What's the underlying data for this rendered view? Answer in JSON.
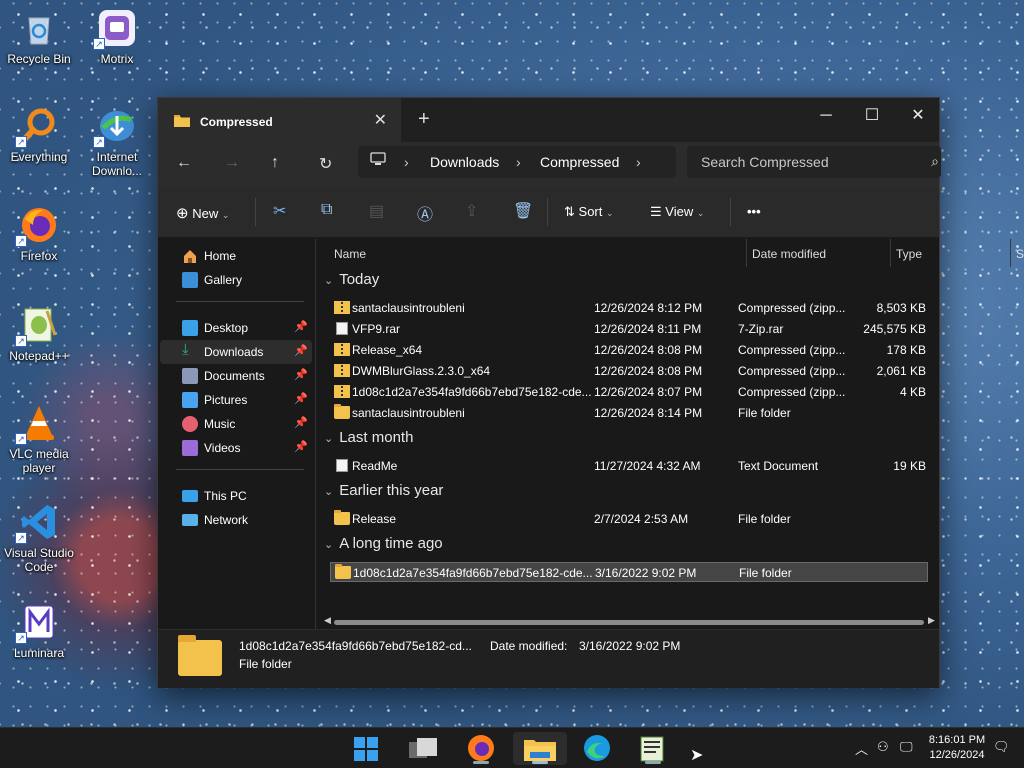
{
  "desktop": {
    "icons": [
      {
        "label": "Recycle Bin",
        "icon": "recycle-bin-icon"
      },
      {
        "label": "Motrix",
        "icon": "motrix-icon"
      },
      {
        "label": "Everything",
        "icon": "everything-search-icon"
      },
      {
        "label": "Internet Downlo...",
        "icon": "internet-download-manager-icon"
      },
      {
        "label": "Firefox",
        "icon": "firefox-icon"
      },
      {
        "label": "Notepad++",
        "icon": "notepad-plus-plus-icon"
      },
      {
        "label": "VLC media player",
        "icon": "vlc-icon"
      },
      {
        "label": "Visual Studio Code",
        "icon": "vscode-icon"
      },
      {
        "label": "Luminara",
        "icon": "luminara-icon"
      }
    ]
  },
  "window": {
    "tab_title": "Compressed",
    "new_tab": "+",
    "close_tab": "✕",
    "controls": {
      "minimize": "─",
      "maximize": "☐",
      "close": "✕"
    }
  },
  "address": {
    "crumbs": [
      "Downloads",
      "Compressed"
    ],
    "search_placeholder": "Search Compressed"
  },
  "commands": {
    "new": "New",
    "sort": "Sort",
    "view": "View",
    "more": "•••"
  },
  "nav": {
    "home": "Home",
    "gallery": "Gallery",
    "pinned": [
      {
        "label": "Desktop",
        "color": "#3aa0e8"
      },
      {
        "label": "Downloads",
        "color": "#2bb673"
      },
      {
        "label": "Documents",
        "color": "#8b98b8"
      },
      {
        "label": "Pictures",
        "color": "#4aa3f0"
      },
      {
        "label": "Music",
        "color": "#e66070"
      },
      {
        "label": "Videos",
        "color": "#9b6bd8"
      }
    ],
    "this_pc": "This PC",
    "network": "Network"
  },
  "columns": {
    "name": "Name",
    "date": "Date modified",
    "type": "Type",
    "size": "Size"
  },
  "groups": [
    {
      "title": "Today",
      "rows": [
        {
          "name": "santaclausintroubleni",
          "date": "12/26/2024 8:12 PM",
          "type": "Compressed (zipp...",
          "size": "8,503 KB",
          "icon": "zip"
        },
        {
          "name": "VFP9.rar",
          "date": "12/26/2024 8:11 PM",
          "type": "7-Zip.rar",
          "size": "245,575 KB",
          "icon": "doc"
        },
        {
          "name": "Release_x64",
          "date": "12/26/2024 8:08 PM",
          "type": "Compressed (zipp...",
          "size": "178 KB",
          "icon": "zip"
        },
        {
          "name": "DWMBlurGlass.2.3.0_x64",
          "date": "12/26/2024 8:08 PM",
          "type": "Compressed (zipp...",
          "size": "2,061 KB",
          "icon": "zip"
        },
        {
          "name": "1d08c1d2a7e354fa9fd66b7ebd75e182-cde...",
          "date": "12/26/2024 8:07 PM",
          "type": "Compressed (zipp...",
          "size": "4 KB",
          "icon": "zip"
        },
        {
          "name": "santaclausintroubleni",
          "date": "12/26/2024 8:14 PM",
          "type": "File folder",
          "size": "",
          "icon": "folder"
        }
      ]
    },
    {
      "title": "Last month",
      "rows": [
        {
          "name": "ReadMe",
          "date": "11/27/2024 4:32 AM",
          "type": "Text Document",
          "size": "19 KB",
          "icon": "doc"
        }
      ]
    },
    {
      "title": "Earlier this year",
      "rows": [
        {
          "name": "Release",
          "date": "2/7/2024 2:53 AM",
          "type": "File folder",
          "size": "",
          "icon": "folder"
        }
      ]
    },
    {
      "title": "A long time ago",
      "rows": [
        {
          "name": "1d08c1d2a7e354fa9fd66b7ebd75e182-cde...",
          "date": "3/16/2022 9:02 PM",
          "type": "File folder",
          "size": "",
          "icon": "folder",
          "selected": true
        }
      ]
    }
  ],
  "details": {
    "name": "1d08c1d2a7e354fa9fd66b7ebd75e182-cd...",
    "date_label": "Date modified:",
    "date_value": "3/16/2022 9:02 PM",
    "type": "File folder"
  },
  "taskbar": {
    "time": "8:16:01 PM",
    "date": "12/26/2024"
  }
}
